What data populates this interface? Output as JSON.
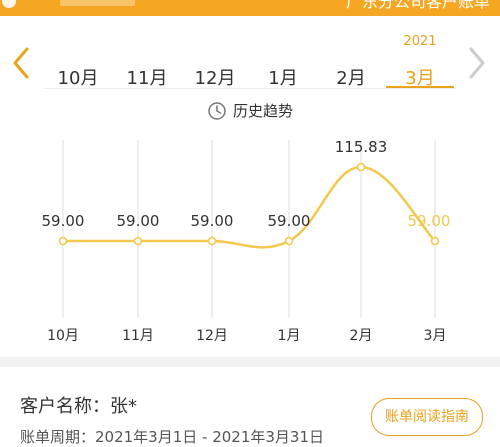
{
  "header": {
    "title": "广东分公司客户账单"
  },
  "month_tabs": {
    "items": [
      "10月",
      "11月",
      "12月",
      "1月",
      "2月",
      "3月"
    ],
    "active_year": "2021",
    "active_index": 5
  },
  "trend": {
    "title": "历史趋势"
  },
  "chart_data": {
    "type": "line",
    "categories": [
      "10月",
      "11月",
      "12月",
      "1月",
      "2月",
      "3月"
    ],
    "values": [
      59.0,
      59.0,
      59.0,
      59.0,
      115.83,
      59.0
    ],
    "value_labels": [
      "59.00",
      "59.00",
      "59.00",
      "59.00",
      "115.83",
      "59.00"
    ],
    "color": "#f2c94c",
    "grid": "vertical"
  },
  "customer": {
    "name_label": "客户名称：张*",
    "period_label": "账单周期：2021年3月1日 - 2021年3月31日"
  },
  "guide_button": {
    "label": "账单阅读指南"
  },
  "colors": {
    "accent": "#e8a21c",
    "header_bg": "#f5a623",
    "line": "#f2c94c"
  }
}
